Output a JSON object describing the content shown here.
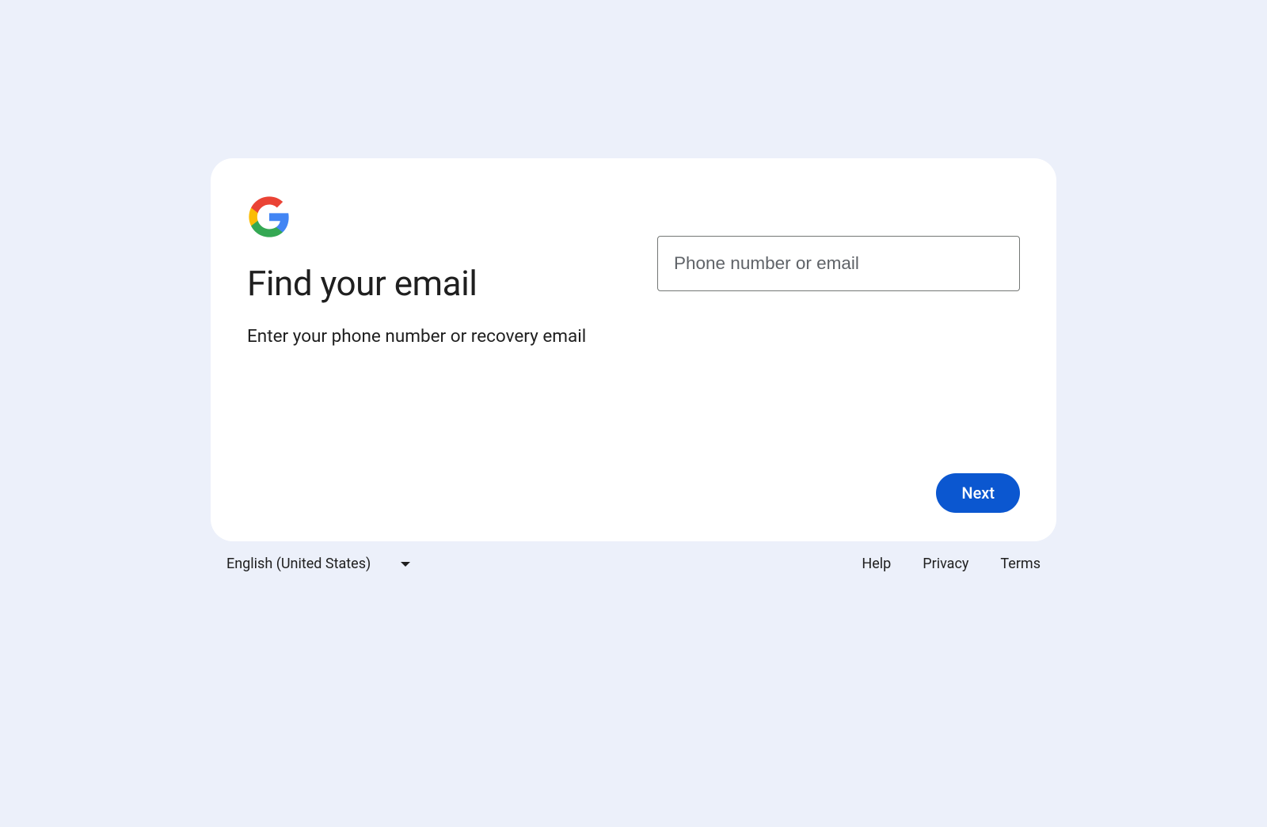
{
  "card": {
    "title": "Find your email",
    "subtitle": "Enter your phone number or recovery email",
    "input_placeholder": "Phone number or email",
    "next_button": "Next"
  },
  "footer": {
    "language": "English (United States)",
    "links": {
      "help": "Help",
      "privacy": "Privacy",
      "terms": "Terms"
    }
  }
}
